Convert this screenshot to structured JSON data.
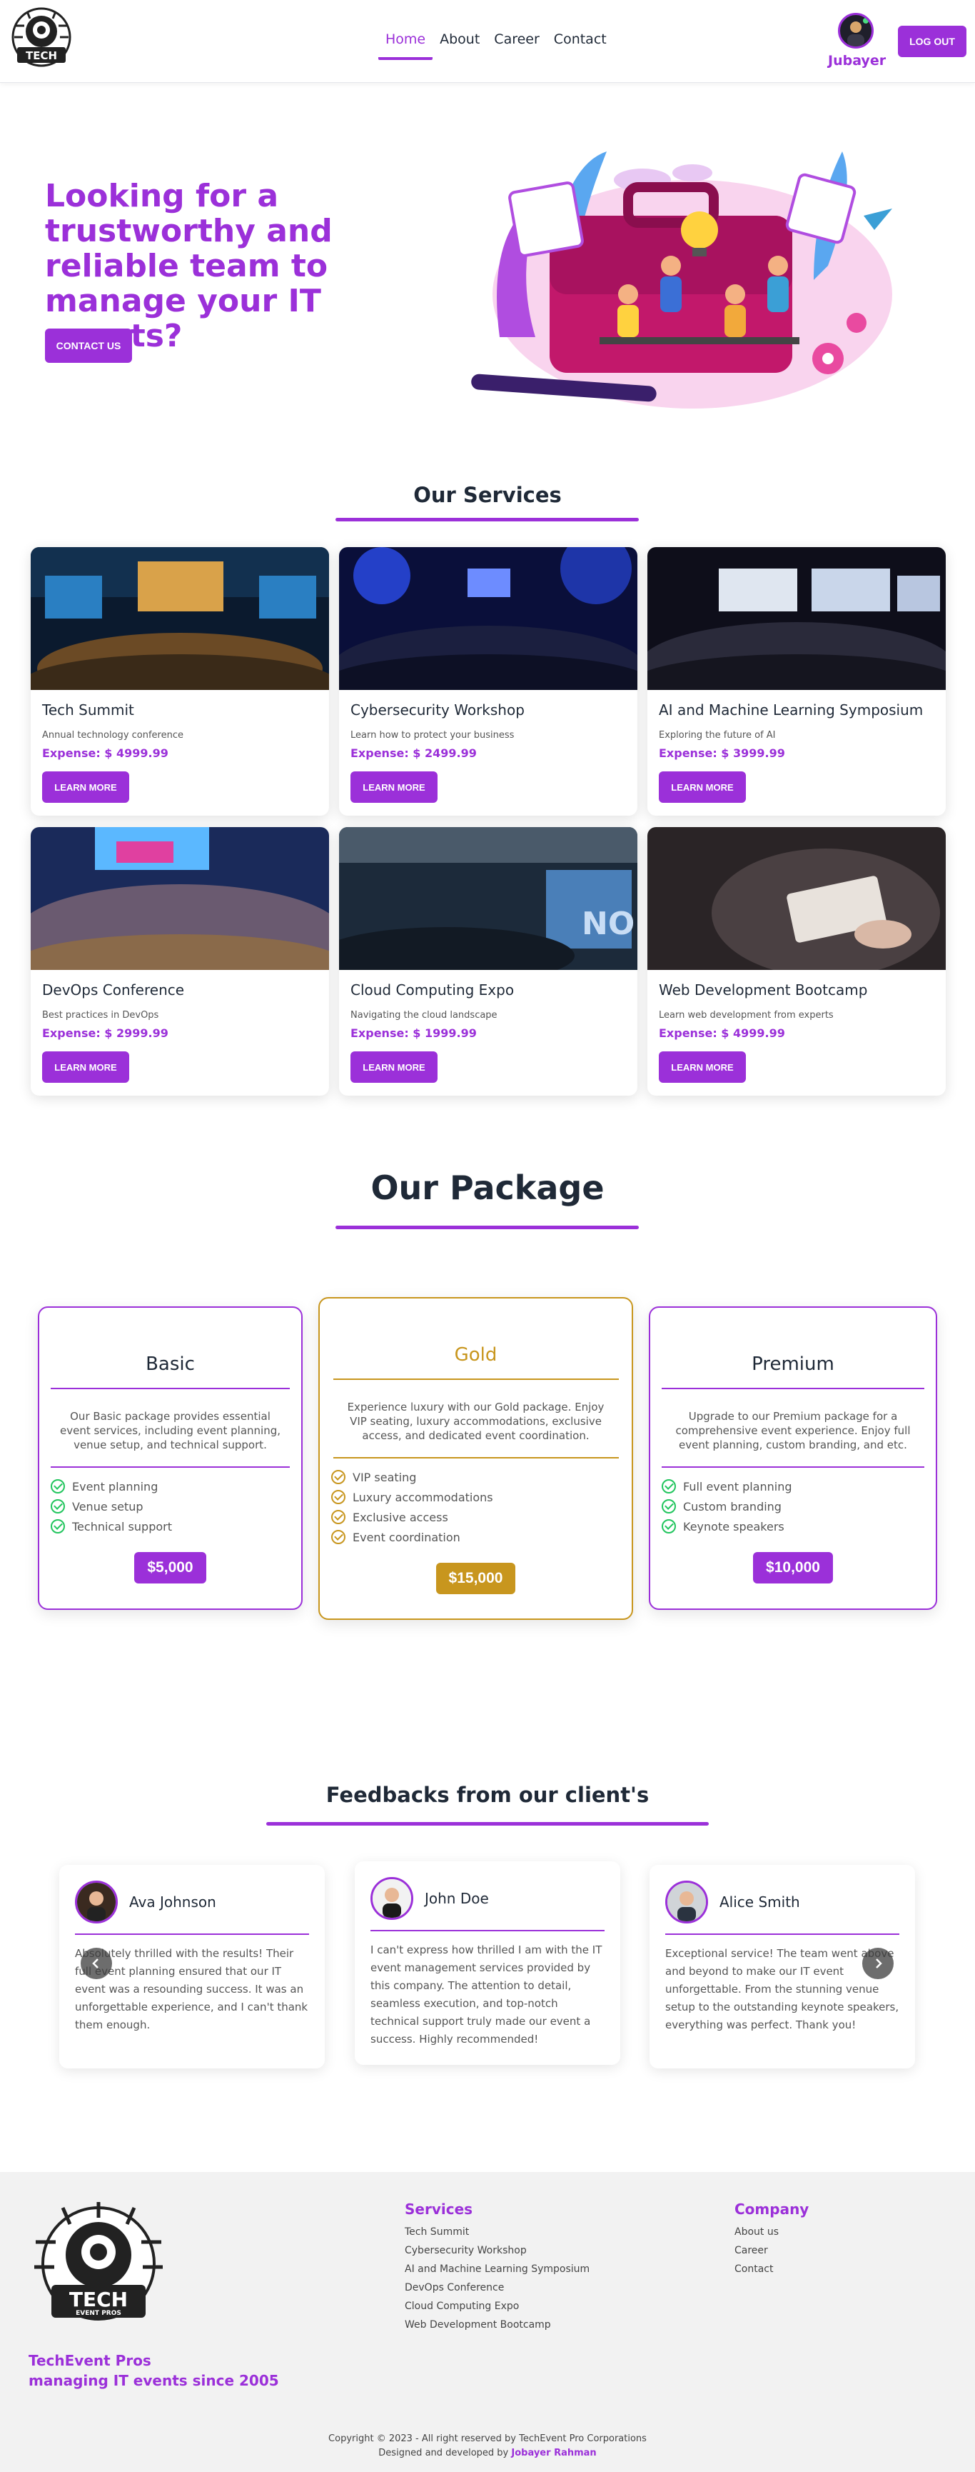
{
  "brand": {
    "accent": "#9b30d9",
    "gold": "#c8961e"
  },
  "nav": {
    "links": [
      "Home",
      "About",
      "Career",
      "Contact"
    ],
    "user_name": "Jubayer",
    "logout": "LOG OUT"
  },
  "hero": {
    "title": "Looking for a trustworthy and reliable team to manage your IT events?",
    "cta": "CONTACT US"
  },
  "services": {
    "title": "Our Services",
    "items": [
      {
        "title": "Tech Summit",
        "desc": "Annual technology conference",
        "expense": "Expense: $ 4999.99",
        "button": "LEARN MORE"
      },
      {
        "title": "Cybersecurity Workshop",
        "desc": "Learn how to protect your business",
        "expense": "Expense: $ 2499.99",
        "button": "LEARN MORE"
      },
      {
        "title": "AI and Machine Learning Symposium",
        "desc": "Exploring the future of AI",
        "expense": "Expense: $ 3999.99",
        "button": "LEARN MORE"
      },
      {
        "title": "DevOps Conference",
        "desc": "Best practices in DevOps",
        "expense": "Expense: $ 2999.99",
        "button": "LEARN MORE"
      },
      {
        "title": "Cloud Computing Expo",
        "desc": "Navigating the cloud landscape",
        "expense": "Expense: $ 1999.99",
        "button": "LEARN MORE"
      },
      {
        "title": "Web Development Bootcamp",
        "desc": "Learn web development from experts",
        "expense": "Expense: $ 4999.99",
        "button": "LEARN MORE"
      }
    ]
  },
  "package": {
    "title": "Our Package",
    "plans": [
      {
        "name": "Basic",
        "desc": "Our Basic package provides essential event services, including event planning, venue setup, and technical support.",
        "features": [
          "Event planning",
          "Venue setup",
          "Technical support"
        ],
        "price": "$5,000"
      },
      {
        "name": "Gold",
        "desc": "Experience luxury with our Gold package. Enjoy VIP seating, luxury accommodations, exclusive access, and dedicated event coordination.",
        "features": [
          "VIP seating",
          "Luxury accommodations",
          "Exclusive access",
          "Event coordination"
        ],
        "price": "$15,000"
      },
      {
        "name": "Premium",
        "desc": "Upgrade to our Premium package for a comprehensive event experience. Enjoy full event planning, custom branding, and etc.",
        "features": [
          "Full event planning",
          "Custom branding",
          "Keynote speakers"
        ],
        "price": "$10,000"
      }
    ]
  },
  "feedback": {
    "title": "Feedbacks from our client's",
    "items": [
      {
        "name": "Ava Johnson",
        "text": "Absolutely thrilled with the results! Their full event planning ensured that our IT event was a resounding success. It was an unforgettable experience, and I can't thank them enough."
      },
      {
        "name": "John Doe",
        "text": "I can't express how thrilled I am with the IT event management services provided by this company. The attention to detail, seamless execution, and top-notch technical support truly made our event a success. Highly recommended!"
      },
      {
        "name": "Alice Smith",
        "text": "Exceptional service! The team went above and beyond to make our IT event unforgettable. From the stunning venue setup to the outstanding keynote speakers, everything was perfect. Thank you!"
      }
    ]
  },
  "footer": {
    "brand_line1": "TechEvent Pros",
    "brand_line2": "managing IT events since 2005",
    "logo_text": "TECH",
    "logo_sub": "EVENT PROS",
    "services_title": "Services",
    "services": [
      "Tech Summit",
      "Cybersecurity Workshop",
      "AI and Machine Learning Symposium",
      "DevOps Conference",
      "Cloud Computing Expo",
      "Web Development Bootcamp"
    ],
    "company_title": "Company",
    "company": [
      "About us",
      "Career",
      "Contact"
    ],
    "copyright": "Copyright © 2023 - All right reserved by TechEvent Pro Corporations",
    "designed_by": "Designed and developed by",
    "developer": "Jobayer Rahman"
  }
}
